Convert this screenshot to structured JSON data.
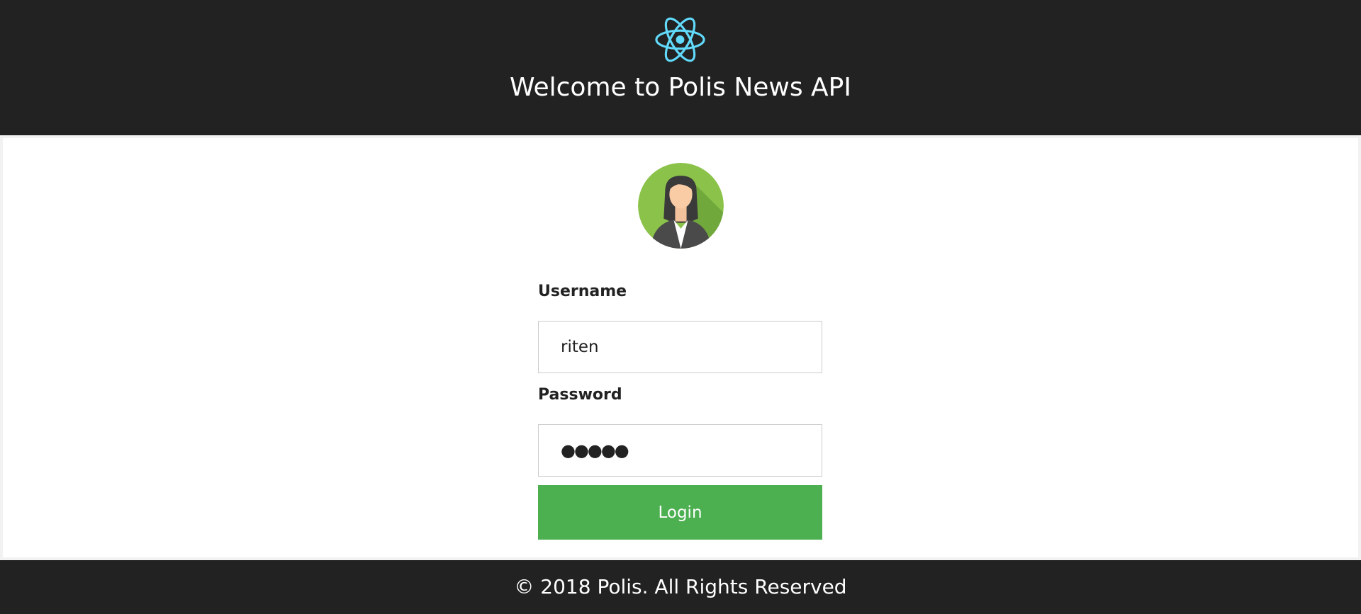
{
  "header": {
    "logo_icon": "react-atom-icon",
    "title": "Welcome to Polis News API"
  },
  "login_form": {
    "avatar_icon": "female-user-avatar-icon",
    "username_label": "Username",
    "username_value": "riten",
    "password_label": "Password",
    "password_value": "●●●●●",
    "login_label": "Login"
  },
  "footer": {
    "copyright": "© 2018 Polis. All Rights Reserved"
  },
  "colors": {
    "header_bg": "#222222",
    "accent_react": "#61dafb",
    "login_button": "#4caf50",
    "avatar_bg": "#8bc34a"
  }
}
